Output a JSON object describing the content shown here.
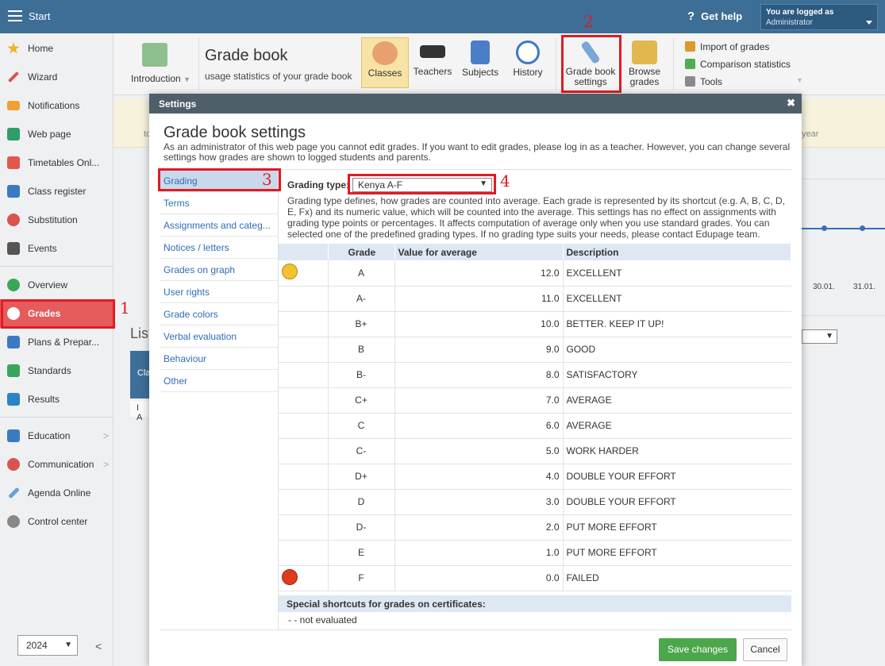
{
  "topbar": {
    "start": "Start",
    "help": "Get help",
    "logged_title": "You are logged as",
    "logged_user": "Administrator"
  },
  "sidebar": {
    "items": [
      "Home",
      "Wizard",
      "Notifications",
      "Web page",
      "Timetables Onl...",
      "Class register",
      "Substitution",
      "Events",
      "Overview",
      "Grades",
      "Plans & Prepar...",
      "Standards",
      "Results",
      "Education",
      "Communication",
      "Agenda Online",
      "Control center"
    ],
    "year": "2024"
  },
  "toolbar": {
    "introduction": "Introduction",
    "title": "Grade book",
    "subtitle": "usage statistics of your grade book",
    "buttons": [
      "Classes",
      "Teachers",
      "Subjects",
      "History"
    ],
    "settings_l1": "Grade book",
    "settings_l2": "settings",
    "browse_l1": "Browse",
    "browse_l2": "grades",
    "right": [
      "Import of grades",
      "Comparison statistics",
      "Tools"
    ]
  },
  "background": {
    "to": "to",
    "year": "year",
    "dates": [
      "30.01.",
      "31.01."
    ],
    "list": "Lis",
    "cla": "Cla",
    "ia": "I A"
  },
  "annotations": [
    "1",
    "2",
    "3",
    "4"
  ],
  "modal": {
    "header": "Settings",
    "close": "✖",
    "title": "Grade book settings",
    "desc": "As an administrator of this web page you cannot edit grades. If you want to edit grades, please log in as a teacher. However, you can change several settings how grades are shown to logged students and parents.",
    "nav": [
      "Grading",
      "Terms",
      "Assignments and categ...",
      "Notices / letters",
      "Grades on graph",
      "User rights",
      "Grade colors",
      "Verbal evaluation",
      "Behaviour",
      "Other"
    ],
    "grading_type_label": "Grading type:",
    "grading_type_value": "Kenya A-F",
    "grading_desc": "Grading type defines, how grades are counted into average. Each grade is represented by its shortcut (e.g. A, B, C, D, E, Fx) and its numeric value, which will be counted into the average. This settings has no effect on assignments with grading type points or percentages. It affects computation of average only when you use standard grades. You can selected one of the predefined grading types. If no grading type suits your needs, please contact Edupage team.",
    "columns": [
      "Grade",
      "Value for average",
      "Description"
    ],
    "rows": [
      {
        "grade": "A",
        "value": "12.0",
        "desc": "EXCELLENT"
      },
      {
        "grade": "A-",
        "value": "11.0",
        "desc": "EXCELLENT"
      },
      {
        "grade": "B+",
        "value": "10.0",
        "desc": "BETTER. KEEP IT UP!"
      },
      {
        "grade": "B",
        "value": "9.0",
        "desc": "GOOD"
      },
      {
        "grade": "B-",
        "value": "8.0",
        "desc": "SATISFACTORY"
      },
      {
        "grade": "C+",
        "value": "7.0",
        "desc": "AVERAGE"
      },
      {
        "grade": "C",
        "value": "6.0",
        "desc": "AVERAGE"
      },
      {
        "grade": "C-",
        "value": "5.0",
        "desc": "WORK HARDER"
      },
      {
        "grade": "D+",
        "value": "4.0",
        "desc": "DOUBLE YOUR EFFORT"
      },
      {
        "grade": "D",
        "value": "3.0",
        "desc": "DOUBLE YOUR EFFORT"
      },
      {
        "grade": "D-",
        "value": "2.0",
        "desc": "PUT MORE EFFORT"
      },
      {
        "grade": "E",
        "value": "1.0",
        "desc": "PUT MORE EFFORT"
      },
      {
        "grade": "F",
        "value": "0.0",
        "desc": "FAILED"
      }
    ],
    "special_title": "Special shortcuts for grades on certificates:",
    "not_evaluated": "- - not evaluated",
    "save": "Save changes",
    "cancel": "Cancel"
  }
}
